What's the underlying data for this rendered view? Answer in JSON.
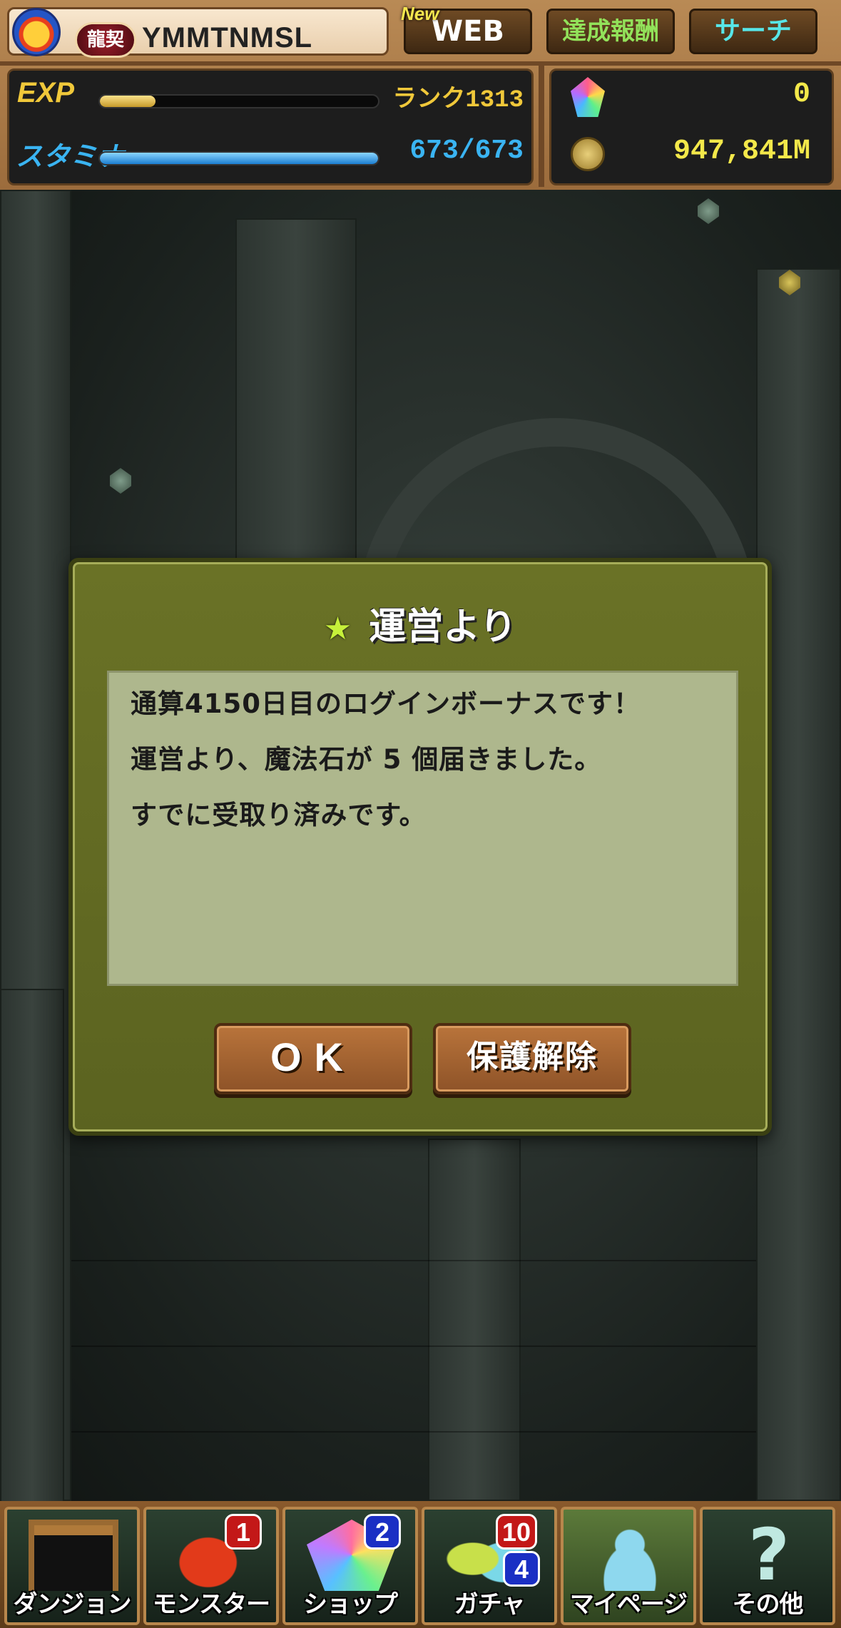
{
  "header": {
    "player_title": "龍契",
    "player_name": "YMMTNMSL",
    "new_tag": "New",
    "web_label": "WEB",
    "achievements_label": "達成報酬",
    "search_label": "サーチ",
    "exp_label": "EXP",
    "exp_progress": 0.2,
    "rank_text": "ランク1313",
    "stamina_label": "スタミナ",
    "stamina_value": "673/673",
    "stamina_progress": 1.0,
    "magic_stones": "0",
    "coins": "947,841M"
  },
  "dialog": {
    "title": "運営より",
    "lines": [
      "通算4150日目のログインボーナスです！",
      "運営より、魔法石が 5 個届きました。",
      "すでに受取り済みです。"
    ],
    "ok_label": "OK",
    "unlock_label": "保護解除"
  },
  "nav": {
    "items": [
      {
        "label": "ダンジョン",
        "badge": ""
      },
      {
        "label": "モンスター",
        "badge": "1"
      },
      {
        "label": "ショップ",
        "badge": "2"
      },
      {
        "label": "ガチャ",
        "badge": "10",
        "badge2": "4"
      },
      {
        "label": "マイページ",
        "badge": ""
      },
      {
        "label": "その他",
        "badge": ""
      }
    ]
  },
  "colors": {
    "exp_bar": "#e8c25a",
    "stamina_bar": "#3aa6f0",
    "dialog_bg": "#5f6722",
    "message_bg": "#aeb78d"
  }
}
